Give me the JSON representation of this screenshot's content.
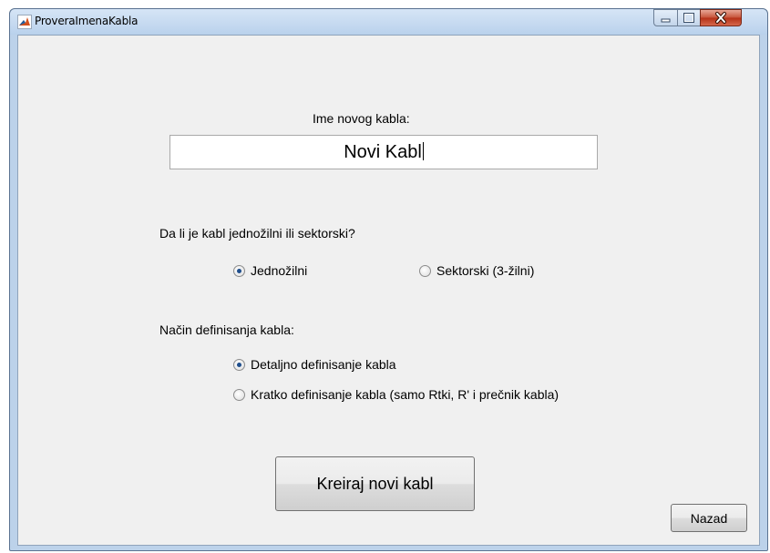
{
  "window": {
    "title": "ProveraImenaKabla"
  },
  "form": {
    "name_label": "Ime novog kabla:",
    "name_value": "Novi Kabl",
    "type_question": "Da li je kabl jednožilni ili sektorski?",
    "type_options": [
      {
        "label": "Jednožilni",
        "selected": true
      },
      {
        "label": "Sektorski (3-žilni)",
        "selected": false
      }
    ],
    "mode_question": "Način definisanja kabla:",
    "mode_options": [
      {
        "label": "Detaljno definisanje kabla",
        "selected": true
      },
      {
        "label": "Kratko definisanje kabla (samo Rtki, R' i prečnik kabla)",
        "selected": false
      }
    ]
  },
  "buttons": {
    "create_label": "Kreiraj novi kabl",
    "back_label": "Nazad"
  },
  "colors": {
    "radio_selected": "#1f4e8c",
    "close_button": "#c8553c"
  }
}
